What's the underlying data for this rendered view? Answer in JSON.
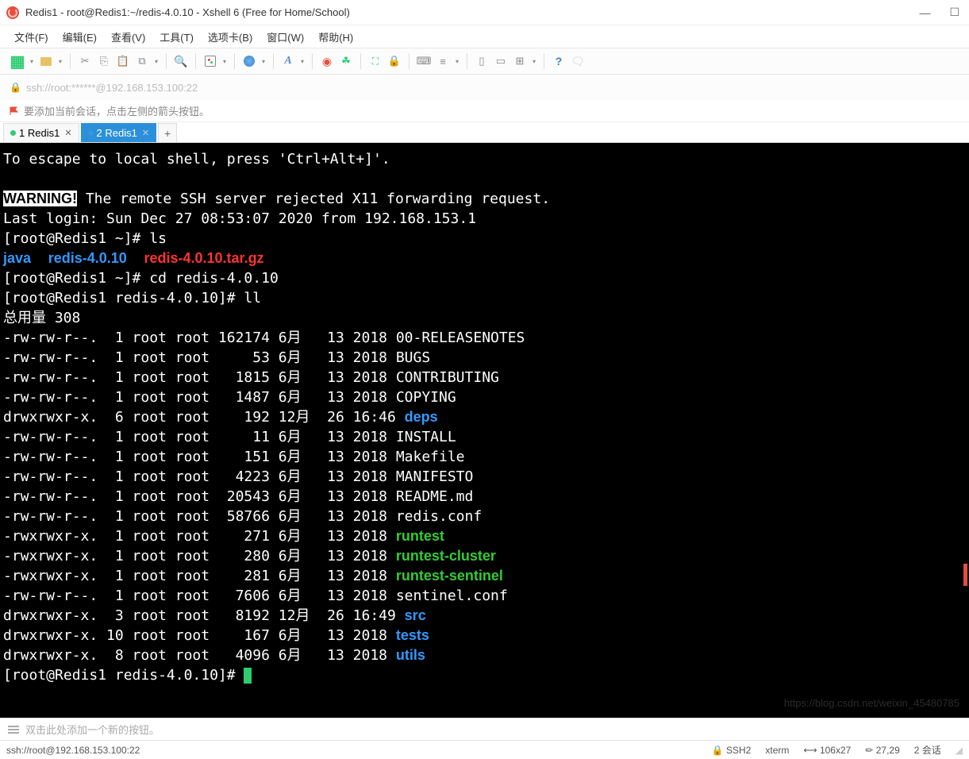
{
  "window": {
    "title": "Redis1 - root@Redis1:~/redis-4.0.10 - Xshell 6 (Free for Home/School)"
  },
  "menu": {
    "file": "文件(F)",
    "edit": "编辑(E)",
    "view": "查看(V)",
    "tools": "工具(T)",
    "tabs": "选项卡(B)",
    "window": "窗口(W)",
    "help": "帮助(H)"
  },
  "addressbar": {
    "text": "ssh://root:******@192.168.153.100:22"
  },
  "infobar": {
    "text": "要添加当前会话，点击左侧的箭头按钮。"
  },
  "tabs": [
    {
      "label": "1 Redis1",
      "active": false
    },
    {
      "label": "2 Redis1",
      "active": true
    }
  ],
  "terminal": {
    "escape": "To escape to local shell, press 'Ctrl+Alt+]'.",
    "warning_label": "WARNING!",
    "warning_text": " The remote SSH server rejected X11 forwarding request.",
    "last_login": "Last login: Sun Dec 27 08:53:07 2020 from 192.168.153.1",
    "prompt1": "[root@Redis1 ~]# ls",
    "ls_java": "java",
    "ls_redis": "redis-4.0.10",
    "ls_tarball": "redis-4.0.10.tar.gz",
    "prompt2": "[root@Redis1 ~]# cd redis-4.0.10",
    "prompt3": "[root@Redis1 redis-4.0.10]# ll",
    "total": "总用量 308",
    "rows": [
      {
        "perm": "-rw-rw-r--.",
        "links": "1",
        "owner": "root",
        "group": "root",
        "size": "162174",
        "month": "6月",
        "day": "13",
        "time": "2018",
        "name": "00-RELEASENOTES",
        "color": ""
      },
      {
        "perm": "-rw-rw-r--.",
        "links": "1",
        "owner": "root",
        "group": "root",
        "size": "53",
        "month": "6月",
        "day": "13",
        "time": "2018",
        "name": "BUGS",
        "color": ""
      },
      {
        "perm": "-rw-rw-r--.",
        "links": "1",
        "owner": "root",
        "group": "root",
        "size": "1815",
        "month": "6月",
        "day": "13",
        "time": "2018",
        "name": "CONTRIBUTING",
        "color": ""
      },
      {
        "perm": "-rw-rw-r--.",
        "links": "1",
        "owner": "root",
        "group": "root",
        "size": "1487",
        "month": "6月",
        "day": "13",
        "time": "2018",
        "name": "COPYING",
        "color": ""
      },
      {
        "perm": "drwxrwxr-x.",
        "links": "6",
        "owner": "root",
        "group": "root",
        "size": "192",
        "month": "12月",
        "day": "26",
        "time": "16:46",
        "name": "deps",
        "color": "blue"
      },
      {
        "perm": "-rw-rw-r--.",
        "links": "1",
        "owner": "root",
        "group": "root",
        "size": "11",
        "month": "6月",
        "day": "13",
        "time": "2018",
        "name": "INSTALL",
        "color": ""
      },
      {
        "perm": "-rw-rw-r--.",
        "links": "1",
        "owner": "root",
        "group": "root",
        "size": "151",
        "month": "6月",
        "day": "13",
        "time": "2018",
        "name": "Makefile",
        "color": ""
      },
      {
        "perm": "-rw-rw-r--.",
        "links": "1",
        "owner": "root",
        "group": "root",
        "size": "4223",
        "month": "6月",
        "day": "13",
        "time": "2018",
        "name": "MANIFESTO",
        "color": ""
      },
      {
        "perm": "-rw-rw-r--.",
        "links": "1",
        "owner": "root",
        "group": "root",
        "size": "20543",
        "month": "6月",
        "day": "13",
        "time": "2018",
        "name": "README.md",
        "color": ""
      },
      {
        "perm": "-rw-rw-r--.",
        "links": "1",
        "owner": "root",
        "group": "root",
        "size": "58766",
        "month": "6月",
        "day": "13",
        "time": "2018",
        "name": "redis.conf",
        "color": ""
      },
      {
        "perm": "-rwxrwxr-x.",
        "links": "1",
        "owner": "root",
        "group": "root",
        "size": "271",
        "month": "6月",
        "day": "13",
        "time": "2018",
        "name": "runtest",
        "color": "green"
      },
      {
        "perm": "-rwxrwxr-x.",
        "links": "1",
        "owner": "root",
        "group": "root",
        "size": "280",
        "month": "6月",
        "day": "13",
        "time": "2018",
        "name": "runtest-cluster",
        "color": "green"
      },
      {
        "perm": "-rwxrwxr-x.",
        "links": "1",
        "owner": "root",
        "group": "root",
        "size": "281",
        "month": "6月",
        "day": "13",
        "time": "2018",
        "name": "runtest-sentinel",
        "color": "green"
      },
      {
        "perm": "-rw-rw-r--.",
        "links": "1",
        "owner": "root",
        "group": "root",
        "size": "7606",
        "month": "6月",
        "day": "13",
        "time": "2018",
        "name": "sentinel.conf",
        "color": ""
      },
      {
        "perm": "drwxrwxr-x.",
        "links": "3",
        "owner": "root",
        "group": "root",
        "size": "8192",
        "month": "12月",
        "day": "26",
        "time": "16:49",
        "name": "src",
        "color": "blue"
      },
      {
        "perm": "drwxrwxr-x.",
        "links": "10",
        "owner": "root",
        "group": "root",
        "size": "167",
        "month": "6月",
        "day": "13",
        "time": "2018",
        "name": "tests",
        "color": "blue"
      },
      {
        "perm": "drwxrwxr-x.",
        "links": "8",
        "owner": "root",
        "group": "root",
        "size": "4096",
        "month": "6月",
        "day": "13",
        "time": "2018",
        "name": "utils",
        "color": "blue"
      }
    ],
    "prompt4": "[root@Redis1 redis-4.0.10]# ",
    "watermark": "https://blog.csdn.net/weixin_45480785"
  },
  "sessionbar": {
    "hint": "双击此处添加一个新的按钮。"
  },
  "statusbar": {
    "left": "ssh://root@192.168.153.100:22",
    "ssh": "SSH2",
    "term": "xterm",
    "size": "106x27",
    "pos": "27,29",
    "sessions": "2 会话"
  }
}
